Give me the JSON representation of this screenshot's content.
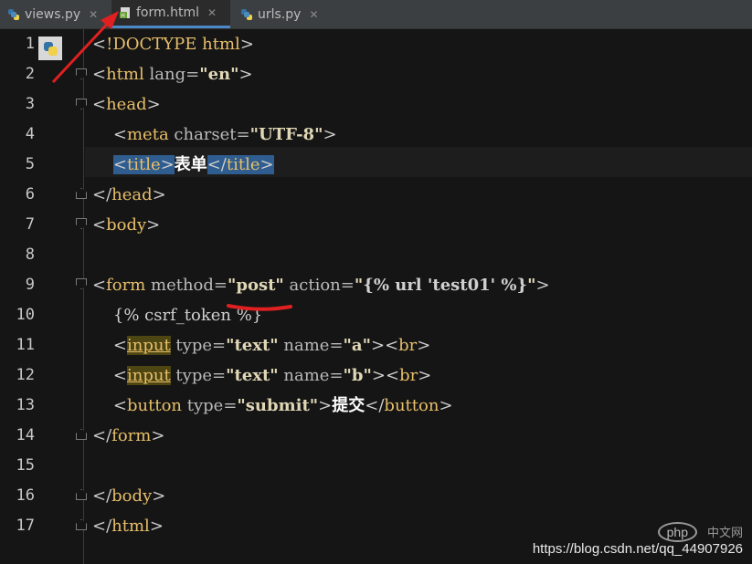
{
  "tabs": [
    {
      "label": "views.py",
      "icon": "python-file-icon",
      "active": false
    },
    {
      "label": "form.html",
      "icon": "html-file-icon",
      "active": true
    },
    {
      "label": "urls.py",
      "icon": "python-file-icon",
      "active": false
    }
  ],
  "lines": [
    {
      "num": "1",
      "code": "<!DOCTYPE html>"
    },
    {
      "num": "2",
      "code": "<html lang=\"en\">"
    },
    {
      "num": "3",
      "code": "<head>"
    },
    {
      "num": "4",
      "code": "    <meta charset=\"UTF-8\">"
    },
    {
      "num": "5",
      "code": "    <title>表单</title>"
    },
    {
      "num": "6",
      "code": "</head>"
    },
    {
      "num": "7",
      "code": "<body>"
    },
    {
      "num": "8",
      "code": ""
    },
    {
      "num": "9",
      "code": "<form method=\"post\" action=\"{% url 'test01' %}\">"
    },
    {
      "num": "10",
      "code": "    {% csrf_token %}"
    },
    {
      "num": "11",
      "code": "    <input type=\"text\" name=\"a\"><br>"
    },
    {
      "num": "12",
      "code": "    <input type=\"text\" name=\"b\"><br>"
    },
    {
      "num": "13",
      "code": "    <button type=\"submit\">提交</button>"
    },
    {
      "num": "14",
      "code": "</form>"
    },
    {
      "num": "15",
      "code": ""
    },
    {
      "num": "16",
      "code": "</body>"
    },
    {
      "num": "17",
      "code": "</html>"
    }
  ],
  "watermark": {
    "url": "https://blog.csdn.net/qq_44907926",
    "logo_text": "php",
    "logo_cn": "中文网"
  },
  "colors": {
    "background": "#151515",
    "tab_bar": "#3c3f41",
    "tag": "#e8bf6a",
    "string": "#e0d7b6",
    "selection": "#2f5d8f",
    "annotation": "#e02020"
  }
}
